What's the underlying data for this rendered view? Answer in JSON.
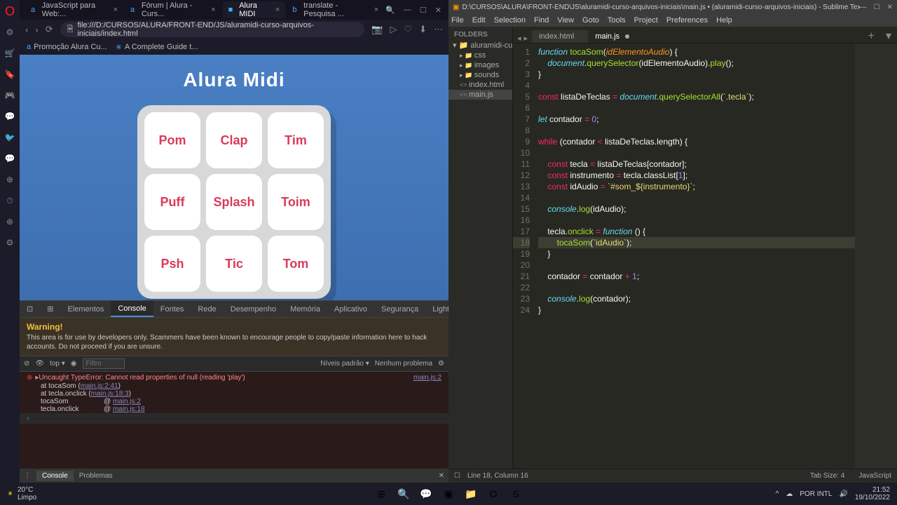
{
  "opera_icons": [
    "O",
    "⚙",
    "🛒",
    "🔖",
    "🎮",
    "💬",
    "🐦",
    "💬",
    "⊕",
    "⏱",
    "⊕",
    "⚙"
  ],
  "browser": {
    "tabs": [
      {
        "label": "JavaScript para Web:...",
        "icon": "a"
      },
      {
        "label": "Fórum | Alura - Curs...",
        "icon": "a"
      },
      {
        "label": "Alura MIDI",
        "icon": "■",
        "active": true
      },
      {
        "label": "translate - Pesquisa ...",
        "icon": "b"
      }
    ],
    "url": "file:///D:/CURSOS/ALURA/FRONT-END/JS/aluramidi-curso-arquivos-iniciais/index.html",
    "bookmarks": [
      {
        "icon": "a",
        "label": "Promoção Alura Cu..."
      },
      {
        "icon": "✳",
        "label": "A Complete Guide t..."
      }
    ]
  },
  "page": {
    "title": "Alura Midi",
    "buttons": [
      "Pom",
      "Clap",
      "Tim",
      "Puff",
      "Splash",
      "Toim",
      "Psh",
      "Tic",
      "Tom"
    ]
  },
  "devtools": {
    "tabs": [
      "Elementos",
      "Console",
      "Fontes",
      "Rede",
      "Desempenho",
      "Memória",
      "Aplicativo",
      "Segurança",
      "Lighthouse"
    ],
    "active_tab": "Console",
    "error_count": "1",
    "warning": {
      "title": "Warning!",
      "text": "This area is for use by developers only. Scammers have been known to encourage people to copy/paste information here to hack accounts. Do not proceed if you are unsure."
    },
    "filter": {
      "scope": "top ▾",
      "placeholder": "Filtro",
      "levels": "Níveis padrão ▾",
      "problems": "Nenhum problema"
    },
    "errors": [
      {
        "msg": "▸Uncaught TypeError: Cannot read properties of null (reading 'play')",
        "link": "main.js:2"
      },
      {
        "sub": "at tocaSom (",
        "u": "main.js:2:41",
        "after": ")"
      },
      {
        "sub": "at tecla.onclick (",
        "u": "main.js:18:3",
        "after": ")"
      },
      {
        "row": "tocaSom",
        "at": "@ ",
        "u": "main.js:2"
      },
      {
        "row": "tecla.onclick",
        "at": "@ ",
        "u": "main.js:18"
      }
    ],
    "bottom": {
      "console": "Console",
      "problems": "Problemas"
    }
  },
  "sublime": {
    "title": "D:\\CURSOS\\ALURA\\FRONT-END\\JS\\aluramidi-curso-arquivos-iniciais\\main.js • (aluramidi-curso-arquivos-iniciais) - Sublime Text (UNREGISTERED)",
    "menu": [
      "File",
      "Edit",
      "Selection",
      "Find",
      "View",
      "Goto",
      "Tools",
      "Project",
      "Preferences",
      "Help"
    ],
    "sidebar": {
      "header": "FOLDERS",
      "root": "aluramidi-curso...",
      "folders": [
        "css",
        "images",
        "sounds"
      ],
      "files": [
        "index.html",
        "main.js"
      ],
      "active": "main.js"
    },
    "tabs": [
      {
        "label": "index.html"
      },
      {
        "label": "main.js",
        "active": true,
        "dirty": true
      }
    ],
    "status": {
      "cursor": "Line 18, Column 16",
      "tabsize": "Tab Size: 4",
      "lang": "JavaScript"
    }
  },
  "code_lines": [
    {
      "n": 1,
      "html": "<span class='kw'>function</span> <span class='fn'>tocaSom</span>(<span class='prm'>idElementoAudio</span>) {"
    },
    {
      "n": 2,
      "html": "    <span class='obj'>document</span>.<span class='fn'>querySelector</span>(idElementoAudio).<span class='fn'>play</span>();"
    },
    {
      "n": 3,
      "html": "}"
    },
    {
      "n": 4,
      "html": ""
    },
    {
      "n": 5,
      "html": "<span class='kw2'>const</span> listaDeTeclas <span class='kw2'>=</span> <span class='obj'>document</span>.<span class='fn'>querySelectorAll</span>(<span class='str'>`.tecla`</span>);"
    },
    {
      "n": 6,
      "html": ""
    },
    {
      "n": 7,
      "html": "<span class='kw'>let</span> contador <span class='kw2'>=</span> <span class='num'>0</span>;"
    },
    {
      "n": 8,
      "html": ""
    },
    {
      "n": 9,
      "html": "<span class='kw2'>while</span> (contador <span class='kw2'>&lt;</span> listaDeTeclas.length) {"
    },
    {
      "n": 10,
      "html": ""
    },
    {
      "n": 11,
      "html": "    <span class='kw2'>const</span> tecla <span class='kw2'>=</span> listaDeTeclas[contador];"
    },
    {
      "n": 12,
      "html": "    <span class='kw2'>const</span> instrumento <span class='kw2'>=</span> tecla.classList[<span class='num'>1</span>];"
    },
    {
      "n": 13,
      "html": "    <span class='kw2'>const</span> idAudio <span class='kw2'>=</span> <span class='str'>`#som_${instrumento}`</span>;"
    },
    {
      "n": 14,
      "html": ""
    },
    {
      "n": 15,
      "html": "    <span class='obj'>console</span>.<span class='fn'>log</span>(idAudio);"
    },
    {
      "n": 16,
      "html": ""
    },
    {
      "n": 17,
      "html": "    tecla.<span class='fn'>onclick</span> <span class='kw2'>=</span> <span class='kw'>function</span> () {"
    },
    {
      "n": 18,
      "html": "        <span class='fn'>tocaSom</span>(<span class='str'>`idAudio`</span>);",
      "hl": true
    },
    {
      "n": 19,
      "html": "    }"
    },
    {
      "n": 20,
      "html": ""
    },
    {
      "n": 21,
      "html": "    contador <span class='kw2'>=</span> contador <span class='kw2'>+</span> <span class='num'>1</span>;"
    },
    {
      "n": 22,
      "html": ""
    },
    {
      "n": 23,
      "html": "    <span class='obj'>console</span>.<span class='fn'>log</span>(contador);"
    },
    {
      "n": 24,
      "html": "}"
    }
  ],
  "taskbar": {
    "weather": {
      "temp": "20°C",
      "desc": "Limpo"
    },
    "icons": [
      "⊞",
      "🔍",
      "💬",
      "▣",
      "📁",
      "O",
      "S"
    ],
    "tray": [
      "^",
      "☁",
      "POR INTL",
      "🔊"
    ],
    "time": "21:52",
    "date": "19/10/2022"
  }
}
